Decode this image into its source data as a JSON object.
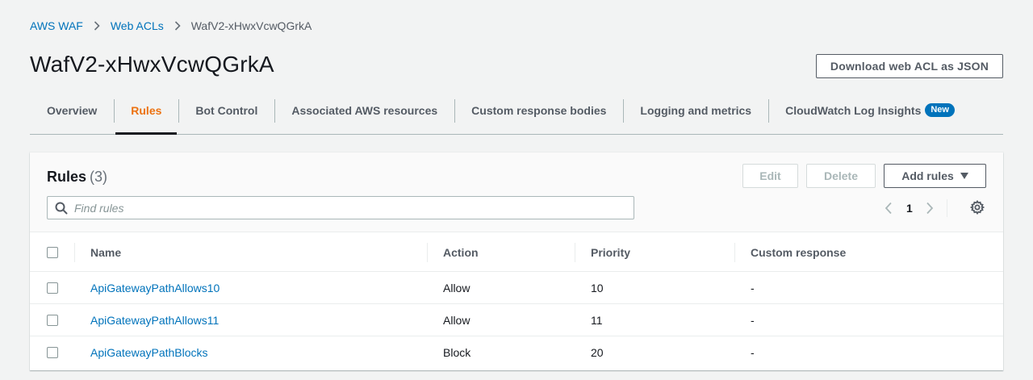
{
  "breadcrumb": {
    "items": [
      "AWS WAF",
      "Web ACLs"
    ],
    "current": "WafV2-xHwxVcwQGrkA"
  },
  "page": {
    "title": "WafV2-xHwxVcwQGrkA",
    "download_label": "Download web ACL as JSON"
  },
  "tabs": [
    {
      "label": "Overview"
    },
    {
      "label": "Rules"
    },
    {
      "label": "Bot Control"
    },
    {
      "label": "Associated AWS resources"
    },
    {
      "label": "Custom response bodies"
    },
    {
      "label": "Logging and metrics"
    },
    {
      "label": "CloudWatch Log Insights",
      "badge": "New"
    }
  ],
  "active_tab": "Rules",
  "rules_panel": {
    "title": "Rules",
    "count": "(3)",
    "edit_label": "Edit",
    "delete_label": "Delete",
    "add_label": "Add rules",
    "search_placeholder": "Find rules",
    "page_number": "1"
  },
  "table": {
    "columns": [
      "Name",
      "Action",
      "Priority",
      "Custom response"
    ],
    "rows": [
      {
        "name": "ApiGatewayPathAllows10",
        "action": "Allow",
        "priority": "10",
        "custom_response": "-"
      },
      {
        "name": "ApiGatewayPathAllows11",
        "action": "Allow",
        "priority": "11",
        "custom_response": "-"
      },
      {
        "name": "ApiGatewayPathBlocks",
        "action": "Block",
        "priority": "20",
        "custom_response": "-"
      }
    ]
  },
  "colors": {
    "link": "#0073bb",
    "active_tab": "#ec7211",
    "badge": "#0073bb",
    "background": "#f2f3f3"
  }
}
